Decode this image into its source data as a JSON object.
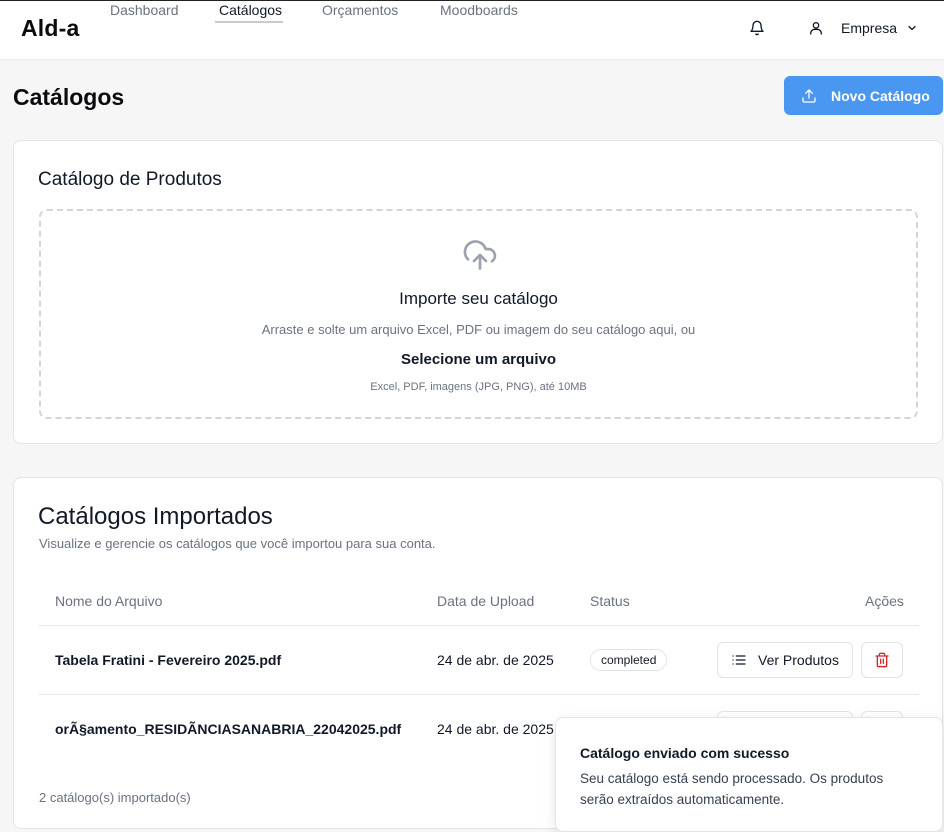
{
  "app": {
    "logo": "Ald-a"
  },
  "nav": {
    "items": [
      {
        "label": "Dashboard"
      },
      {
        "label": "Catálogos",
        "active": true
      },
      {
        "label": "Orçamentos"
      },
      {
        "label": "Moodboards"
      }
    ]
  },
  "header": {
    "user_label": "Empresa",
    "icons": [
      "bell-icon",
      "user-icon",
      "chevron-down-icon"
    ]
  },
  "page": {
    "title": "Catálogos",
    "new_button_label": "Novo Catálogo",
    "accent_color": "#4a97f1"
  },
  "upload_card": {
    "title": "Catálogo de Produtos",
    "dropzone_title": "Importe seu catálogo",
    "dropzone_description": "Arraste e solte um arquivo Excel, PDF ou imagem do seu catálogo aqui, ou",
    "select_label": "Selecione um arquivo",
    "hint": "Excel, PDF, imagens (JPG, PNG), até 10MB"
  },
  "imported_card": {
    "title": "Catálogos Importados",
    "subtitle": "Visualize e gerencie os catálogos que você importou para sua conta.",
    "columns": [
      "Nome do Arquivo",
      "Data de Upload",
      "Status",
      "Ações"
    ],
    "rows": [
      {
        "file_name": "Tabela Fratini - Fevereiro 2025.pdf",
        "date": "24 de abr. de 2025",
        "status": "completed",
        "view_label": "Ver Produtos"
      },
      {
        "file_name": "orÃ§amento_RESIDÃNCIASANABRIA_22042025.pdf",
        "date": "24 de abr. de 2025",
        "status": "",
        "view_label": ""
      }
    ],
    "count_label": "2 catálogo(s) importado(s)"
  },
  "toast": {
    "title": "Catálogo enviado com sucesso",
    "body": "Seu catálogo está sendo processado. Os produtos serão extraídos automaticamente."
  },
  "colors": {
    "delete_icon": "#dc2626",
    "text_muted": "#6b7280"
  }
}
